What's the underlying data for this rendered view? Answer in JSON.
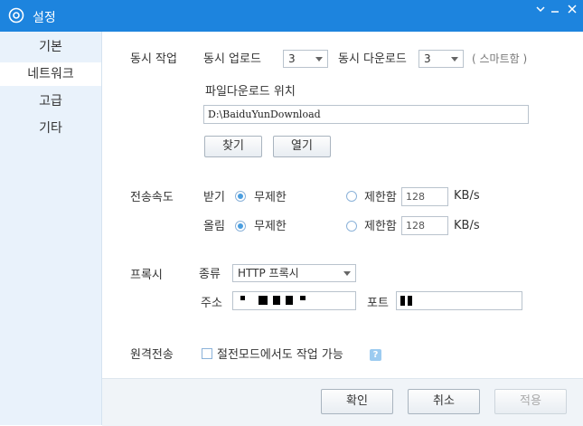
{
  "window": {
    "title": "설정"
  },
  "sidebar": {
    "items": [
      {
        "label": "기본"
      },
      {
        "label": "네트워크"
      },
      {
        "label": "고급"
      },
      {
        "label": "기타"
      }
    ]
  },
  "concurrent": {
    "section_label": "동시 작업",
    "upload_label": "동시 업로드",
    "upload_value": "3",
    "download_label": "동시 다운로드",
    "download_value": "3",
    "smart_note": "( 스마트함 )",
    "location_label": "파일다운로드 위치",
    "location_value": "D:\\BaiduYunDownload",
    "browse_button": "찾기",
    "open_button": "열기"
  },
  "speed": {
    "section_label": "전송속도",
    "download_label": "받기",
    "upload_label": "올림",
    "unlimited_label": "무제한",
    "limit_label": "제한함",
    "download_limit": "128",
    "upload_limit": "128",
    "unit": "KB/s"
  },
  "proxy": {
    "section_label": "프록시",
    "type_label": "종류",
    "type_value": "HTTP 프록시",
    "address_label": "주소",
    "port_label": "포트"
  },
  "remote": {
    "section_label": "원격전송",
    "checkbox_label": "절전모드에서도 작업 가능",
    "help_glyph": "?"
  },
  "footer": {
    "ok": "확인",
    "cancel": "취소",
    "apply": "적용"
  }
}
